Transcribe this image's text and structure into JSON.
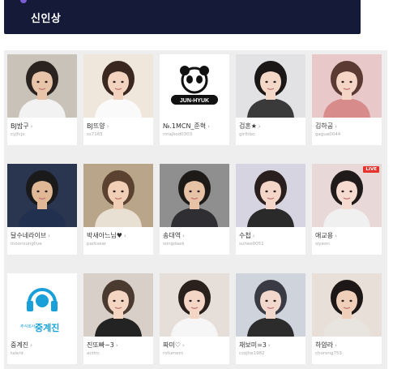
{
  "header": {
    "title": "신인상"
  },
  "colors": {
    "header_bg": "#151a38",
    "panel_bg": "#eeeeef",
    "live_badge": "#e5322d"
  },
  "cards": [
    {
      "name": "BJ밤구",
      "id": "cyjfcjx",
      "bg": "#c9c2b8",
      "skin": "#e8c4a8",
      "hair": "#2a2320",
      "shirt": "#f2f2f2"
    },
    {
      "name": "BJ뜨양",
      "id": "ss7165",
      "bg": "#efe6dc",
      "skin": "#f1d3bf",
      "hair": "#3a2820",
      "shirt": "#fafafa"
    },
    {
      "name": "№.1MCN_준혁",
      "id": "rmajkod0303",
      "logo": "JUN-HYUK",
      "bg": "#ffffff"
    },
    {
      "name": "검혼★",
      "id": "girltibo",
      "bg": "#e2e2e4",
      "skin": "#f3d8c8",
      "hair": "#1c1717",
      "shirt": "#3a3a3a"
    },
    {
      "name": "김하공",
      "id": "gagua0044",
      "bg": "#e8c8c8",
      "skin": "#f4d5c6",
      "hair": "#5a3a32",
      "shirt": "#d88b8b"
    },
    {
      "name": "달수네라이브",
      "id": "moonsunglive",
      "bg": "#2a3550",
      "skin": "#e0b896",
      "hair": "#1a1a1a",
      "shirt": "#22304f"
    },
    {
      "name": "박새아느님♥",
      "id": "parksear",
      "bg": "#b9a58a",
      "skin": "#f0cfb6",
      "hair": "#5b4230",
      "shirt": "#e9e0d4"
    },
    {
      "name": "송대역",
      "id": "songdaek",
      "bg": "#8f8f8f",
      "skin": "#e6c2a6",
      "hair": "#1d1a18",
      "shirt": "#2e2e33"
    },
    {
      "name": "수첩",
      "id": "suhee0051",
      "bg": "#d6d4e0",
      "skin": "#f3d6c7",
      "hair": "#2a1f1f",
      "shirt": "#2a2a2a"
    },
    {
      "name": "애교용",
      "id": "siyeon",
      "bg": "#e9d8d8",
      "skin": "#f5dbd0",
      "hair": "#201a1a",
      "shirt": "#f0f0f0",
      "live": "LIVE"
    },
    {
      "name": "중계진",
      "id": "talent",
      "logo": "중계진",
      "logo_small": "주식회사",
      "bg": "#ffffff"
    },
    {
      "name": "진또빠~3",
      "id": "acttrc",
      "bg": "#d8d0c8",
      "skin": "#f3d5c2",
      "hair": "#4a3a30",
      "shirt": "#232323"
    },
    {
      "name": "짜미♡",
      "id": "rofumem",
      "bg": "#e6ded8",
      "skin": "#f4d6c6",
      "hair": "#2a201c",
      "shirt": "#f6f6f6"
    },
    {
      "name": "채보미=3",
      "id": "csxjhe1982",
      "bg": "#cfd4dc",
      "skin": "#f2d8cc",
      "hair": "#3a3a44",
      "shirt": "#2c2c2c"
    },
    {
      "name": "하얌라",
      "id": "chorong753",
      "bg": "#e8e0d8",
      "skin": "#f0cfba",
      "hair": "#1d1817",
      "shirt": "#e8e4e0"
    }
  ]
}
